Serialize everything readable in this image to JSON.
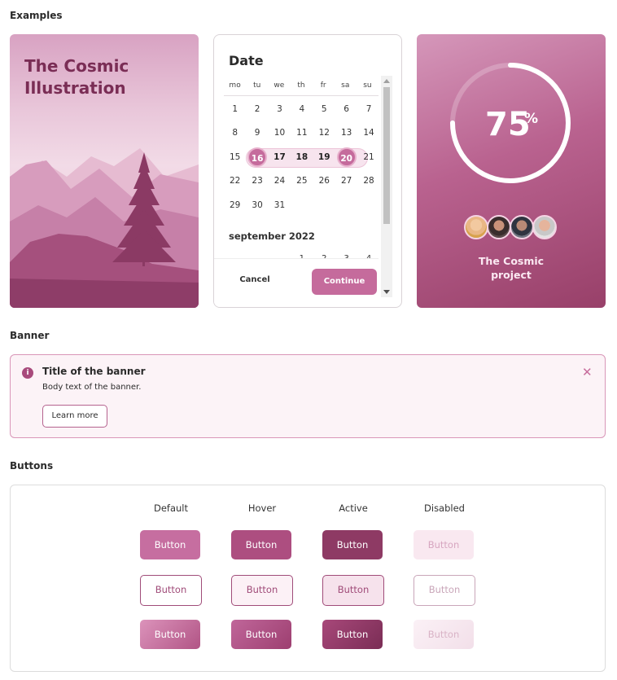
{
  "sections": {
    "examples": "Examples",
    "banner": "Banner",
    "buttons": "Buttons"
  },
  "illustration_card": {
    "title": "The Cosmic Illustration"
  },
  "date_card": {
    "title": "Date",
    "weekdays": [
      "mo",
      "tu",
      "we",
      "th",
      "fr",
      "sa",
      "su"
    ],
    "weeks": [
      [
        "1",
        "2",
        "3",
        "4",
        "5",
        "6",
        "7"
      ],
      [
        "8",
        "9",
        "10",
        "11",
        "12",
        "13",
        "14"
      ],
      [
        "15",
        "16",
        "17",
        "18",
        "19",
        "20",
        "21"
      ],
      [
        "22",
        "23",
        "24",
        "25",
        "26",
        "27",
        "28"
      ],
      [
        "29",
        "30",
        "31",
        "",
        "",
        "",
        ""
      ]
    ],
    "selected_range": [
      "16",
      "20"
    ],
    "next_month_label": "september 2022",
    "next_month_partial_row": [
      "",
      "",
      "",
      "1",
      "2",
      "3",
      "4"
    ],
    "cancel_label": "Cancel",
    "continue_label": "Continue"
  },
  "progress_card": {
    "value": "75",
    "unit": "%",
    "progress": 0.75,
    "label_line1": "The Cosmic",
    "label_line2": "project",
    "avatars": [
      "avatar-1",
      "avatar-2",
      "avatar-3",
      "avatar-4"
    ]
  },
  "banner": {
    "icon": "info-icon",
    "icon_glyph": "i",
    "title": "Title of the banner",
    "body": "Body text of the banner.",
    "button_label": "Learn more",
    "close_glyph": "✕"
  },
  "buttons_panel": {
    "columns": [
      "Default",
      "Hover",
      "Active",
      "Disabled"
    ],
    "button_label": "Button"
  },
  "colors": {
    "accent": "#c56b9c",
    "accent_dark": "#8e3a64",
    "title_plum": "#7a2d55"
  }
}
